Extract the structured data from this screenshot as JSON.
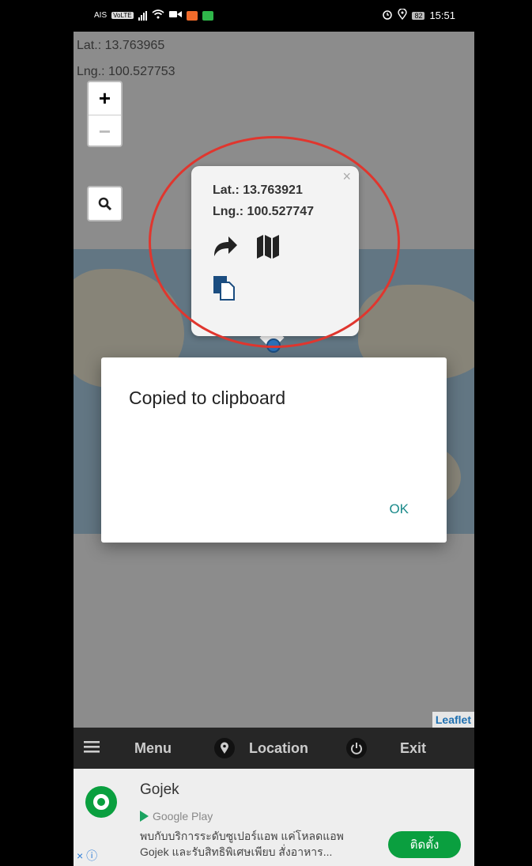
{
  "status_bar": {
    "carrier": "AIS",
    "carrier_badge": "VoLTE",
    "battery": "82",
    "time": "15:51"
  },
  "map": {
    "lat_text": "Lat.: 13.763965",
    "lng_text": "Lng.: 100.527753",
    "zoom_in": "+",
    "zoom_out": "−",
    "attribution": "Leaflet"
  },
  "popup": {
    "close": "×",
    "lat": "Lat.: 13.763921",
    "lng": "Lng.: 100.527747",
    "icons": [
      "share-arrow-icon",
      "map-icon",
      "copy-icon"
    ]
  },
  "dialog": {
    "message": "Copied to clipboard",
    "ok_label": "OK"
  },
  "nav": {
    "menu_label": "Menu",
    "location_label": "Location",
    "exit_label": "Exit"
  },
  "ad": {
    "title": "Gojek",
    "store": "Google Play",
    "desc_line1": "พบกับบริการระดับซูเปอร์แอพ แค่โหลดแอพ",
    "desc_line2": "Gojek และรับสิทธิพิเศษเพียบ สั่งอาหาร...",
    "install_label": "ติดตั้ง",
    "close_label": "× ⓘ"
  },
  "colors": {
    "accent": "#1a8a8a",
    "annotation": "#e0362e",
    "ad_green": "#0a9f3f"
  }
}
